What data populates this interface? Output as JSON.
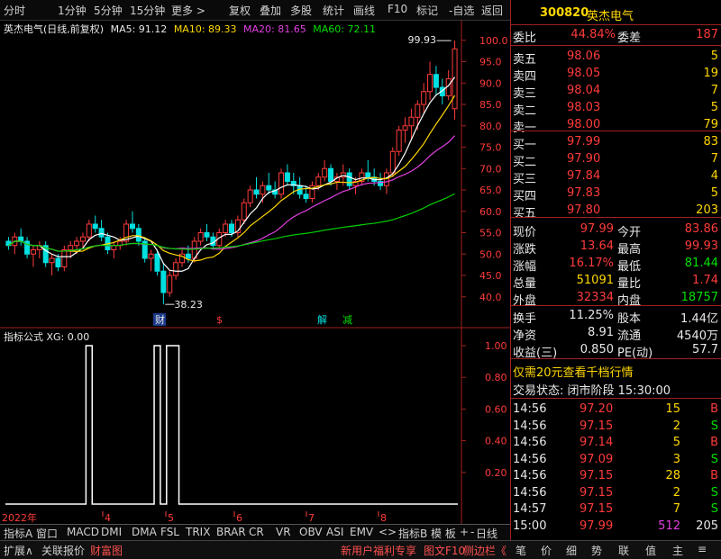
{
  "toolbar": {
    "left": [
      "分时",
      "1分钟",
      "5分钟",
      "15分钟",
      "更多 >"
    ],
    "right": [
      "复权",
      "叠加",
      "多股",
      "统计",
      "画线",
      "F10",
      "标记",
      "-自选",
      "返回"
    ]
  },
  "chart_header": {
    "name": "英杰电气(日线,前复权)",
    "ma5": "MA5: 91.12",
    "ma10": "MA10: 89.33",
    "ma20": "MA20: 81.65",
    "ma60": "MA60: 72.11"
  },
  "price_axis": [
    "100.0",
    "95.0",
    "90.0",
    "85.0",
    "80.0",
    "75.0",
    "70.0",
    "65.0",
    "60.0",
    "55.0",
    "50.0",
    "45.0",
    "40.0"
  ],
  "annotations": {
    "high": "99.93",
    "low": "38.23",
    "marks": [
      "财",
      "$",
      "解",
      "减"
    ]
  },
  "indicator": {
    "title": "指标公式 XG: 0.00",
    "axis": [
      "1.00",
      "0.80",
      "0.60",
      "0.40",
      "0.20"
    ]
  },
  "time_axis": [
    "2022年",
    "4",
    "5",
    "6",
    "7",
    "8"
  ],
  "quote": {
    "code": "300820",
    "name": "英杰电气",
    "webi_label": "委比",
    "webi": "44.84%",
    "weicha_label": "委差",
    "weicha": "187",
    "asks": [
      {
        "label": "卖五",
        "price": "98.06",
        "vol": "5"
      },
      {
        "label": "卖四",
        "price": "98.05",
        "vol": "19"
      },
      {
        "label": "卖三",
        "price": "98.04",
        "vol": "7"
      },
      {
        "label": "卖二",
        "price": "98.03",
        "vol": "5"
      },
      {
        "label": "卖一",
        "price": "98.00",
        "vol": "79"
      }
    ],
    "bids": [
      {
        "label": "买一",
        "price": "97.99",
        "vol": "83"
      },
      {
        "label": "买二",
        "price": "97.90",
        "vol": "7"
      },
      {
        "label": "买三",
        "price": "97.84",
        "vol": "4"
      },
      {
        "label": "买四",
        "price": "97.83",
        "vol": "5"
      },
      {
        "label": "买五",
        "price": "97.80",
        "vol": "203"
      }
    ],
    "stats": [
      {
        "l1": "现价",
        "v1": "97.99",
        "l2": "今开",
        "v2": "83.86"
      },
      {
        "l1": "涨跌",
        "v1": "13.64",
        "l2": "最高",
        "v2": "99.93"
      },
      {
        "l1": "涨幅",
        "v1": "16.17%",
        "l2": "最低",
        "v2": "81.44"
      },
      {
        "l1": "总量",
        "v1": "51091",
        "l2": "量比",
        "v2": "1.74"
      },
      {
        "l1": "外盘",
        "v1": "32334",
        "l2": "内盘",
        "v2": "18757"
      }
    ],
    "stats2": [
      {
        "l1": "换手",
        "v1": "11.25%",
        "l2": "股本",
        "v2": "1.44亿"
      },
      {
        "l1": "净资",
        "v1": "8.91",
        "l2": "流通",
        "v2": "4540万"
      },
      {
        "l1": "收益(三)",
        "v1": "0.850",
        "l2": "PE(动)",
        "v2": "57.7"
      }
    ],
    "promo": "仅需20元查看千档行情",
    "status": "交易状态: 闭市阶段 15:30:00",
    "ticks": [
      {
        "t": "14:56",
        "p": "97.20",
        "v": "15",
        "d": "B"
      },
      {
        "t": "14:56",
        "p": "97.15",
        "v": "2",
        "d": "S"
      },
      {
        "t": "14:56",
        "p": "97.14",
        "v": "5",
        "d": "B"
      },
      {
        "t": "14:56",
        "p": "97.09",
        "v": "3",
        "d": "S"
      },
      {
        "t": "14:56",
        "p": "97.15",
        "v": "28",
        "d": "B"
      },
      {
        "t": "14:56",
        "p": "97.15",
        "v": "2",
        "d": "S"
      },
      {
        "t": "14:57",
        "p": "97.15",
        "v": "7",
        "d": "S"
      },
      {
        "t": "15:00",
        "p": "97.99",
        "v": "512",
        "d": "205"
      }
    ]
  },
  "indicator_tabs": [
    "指标A",
    "窗口",
    "MACD",
    "DMI",
    "DMA",
    "FSL",
    "TRIX",
    "BRAR",
    "CR",
    "VR",
    "OBV",
    "ASI",
    "EMV",
    "<",
    ">",
    "指标B",
    "模 板",
    "+",
    "-",
    "日线"
  ],
  "bottom_tabs": [
    "扩展∧",
    "关联报价",
    "财富图",
    "新用户福利专享",
    "图文F10",
    "侧边栏《",
    "笔",
    "价",
    "细",
    "势",
    "联",
    "值",
    "主",
    "≡"
  ],
  "colors": {
    "up": "#ff3b3b",
    "down": "#00e0e0",
    "ma5": "#ffffff",
    "ma10": "#ffd800",
    "ma20": "#e040e0",
    "ma60": "#00d000"
  },
  "chart_data": {
    "type": "candlestick",
    "ylim": [
      37,
      101
    ],
    "candles": [
      [
        53,
        54,
        51,
        52
      ],
      [
        52,
        55,
        50,
        54
      ],
      [
        54,
        56,
        52,
        53
      ],
      [
        53,
        54,
        49,
        50
      ],
      [
        50,
        52,
        47,
        51
      ],
      [
        51,
        53,
        49,
        52
      ],
      [
        52,
        53,
        47,
        48
      ],
      [
        48,
        50,
        45,
        49
      ],
      [
        49,
        50,
        46,
        47
      ],
      [
        47,
        52,
        46,
        51
      ],
      [
        51,
        53,
        49,
        52
      ],
      [
        52,
        54,
        50,
        53
      ],
      [
        53,
        55,
        51,
        54
      ],
      [
        54,
        58,
        53,
        57
      ],
      [
        57,
        59,
        55,
        56
      ],
      [
        56,
        58,
        53,
        54
      ],
      [
        54,
        55,
        50,
        51
      ],
      [
        51,
        53,
        49,
        52
      ],
      [
        52,
        54,
        51,
        53
      ],
      [
        53,
        58,
        52,
        57
      ],
      [
        57,
        60,
        55,
        56
      ],
      [
        56,
        57,
        52,
        53
      ],
      [
        53,
        54,
        48,
        49
      ],
      [
        49,
        51,
        46,
        50
      ],
      [
        50,
        51,
        45,
        46
      ],
      [
        46,
        48,
        38.23,
        41
      ],
      [
        41,
        46,
        40,
        45
      ],
      [
        45,
        49,
        44,
        48
      ],
      [
        48,
        51,
        47,
        50
      ],
      [
        50,
        52,
        48,
        49
      ],
      [
        49,
        54,
        48,
        53
      ],
      [
        53,
        56,
        52,
        55
      ],
      [
        55,
        57,
        53,
        54
      ],
      [
        54,
        55,
        51,
        52
      ],
      [
        52,
        56,
        51,
        55
      ],
      [
        55,
        58,
        54,
        57
      ],
      [
        57,
        58,
        54,
        55
      ],
      [
        55,
        59,
        54,
        58
      ],
      [
        58,
        63,
        57,
        62
      ],
      [
        62,
        66,
        61,
        65
      ],
      [
        65,
        68,
        63,
        64
      ],
      [
        64,
        67,
        62,
        66
      ],
      [
        66,
        69,
        64,
        65
      ],
      [
        65,
        67,
        63,
        64
      ],
      [
        64,
        70,
        63,
        69
      ],
      [
        69,
        71,
        66,
        67
      ],
      [
        67,
        69,
        64,
        66
      ],
      [
        66,
        68,
        63,
        64
      ],
      [
        64,
        66,
        62,
        63
      ],
      [
        63,
        67,
        62,
        66
      ],
      [
        66,
        69,
        65,
        68
      ],
      [
        68,
        72,
        67,
        70
      ],
      [
        70,
        71,
        66,
        67
      ],
      [
        67,
        69,
        65,
        68
      ],
      [
        68,
        71,
        66,
        69
      ],
      [
        69,
        70,
        65,
        66
      ],
      [
        66,
        68,
        64,
        67
      ],
      [
        67,
        70,
        66,
        69
      ],
      [
        69,
        72,
        67,
        68
      ],
      [
        68,
        70,
        66,
        67
      ],
      [
        67,
        69,
        65,
        66
      ],
      [
        66,
        70,
        64,
        69
      ],
      [
        69,
        75,
        68,
        74
      ],
      [
        74,
        80,
        73,
        79
      ],
      [
        79,
        82,
        76,
        80
      ],
      [
        80,
        84,
        77,
        82
      ],
      [
        82,
        86,
        79,
        85
      ],
      [
        85,
        90,
        83,
        88
      ],
      [
        88,
        95,
        86,
        92
      ],
      [
        92,
        94,
        87,
        89
      ],
      [
        89,
        91,
        85,
        87
      ],
      [
        87,
        93,
        86,
        91
      ],
      [
        84,
        99.93,
        81.44,
        97.99
      ]
    ],
    "xg": [
      0,
      0,
      0,
      0,
      0,
      0,
      0,
      0,
      0,
      0,
      0,
      0,
      0,
      1,
      0,
      0,
      0,
      0,
      0,
      0,
      0,
      0,
      0,
      0,
      1,
      0,
      1,
      1,
      0,
      0,
      0,
      0,
      0,
      0,
      0,
      0,
      0,
      0,
      0,
      0,
      0,
      0,
      0,
      0,
      0,
      0,
      0,
      0,
      0,
      0,
      0,
      0,
      0,
      0,
      0,
      0,
      0,
      0,
      0,
      0,
      0,
      0,
      0,
      0,
      0,
      0,
      0,
      0,
      0,
      0,
      0,
      0,
      0
    ]
  }
}
